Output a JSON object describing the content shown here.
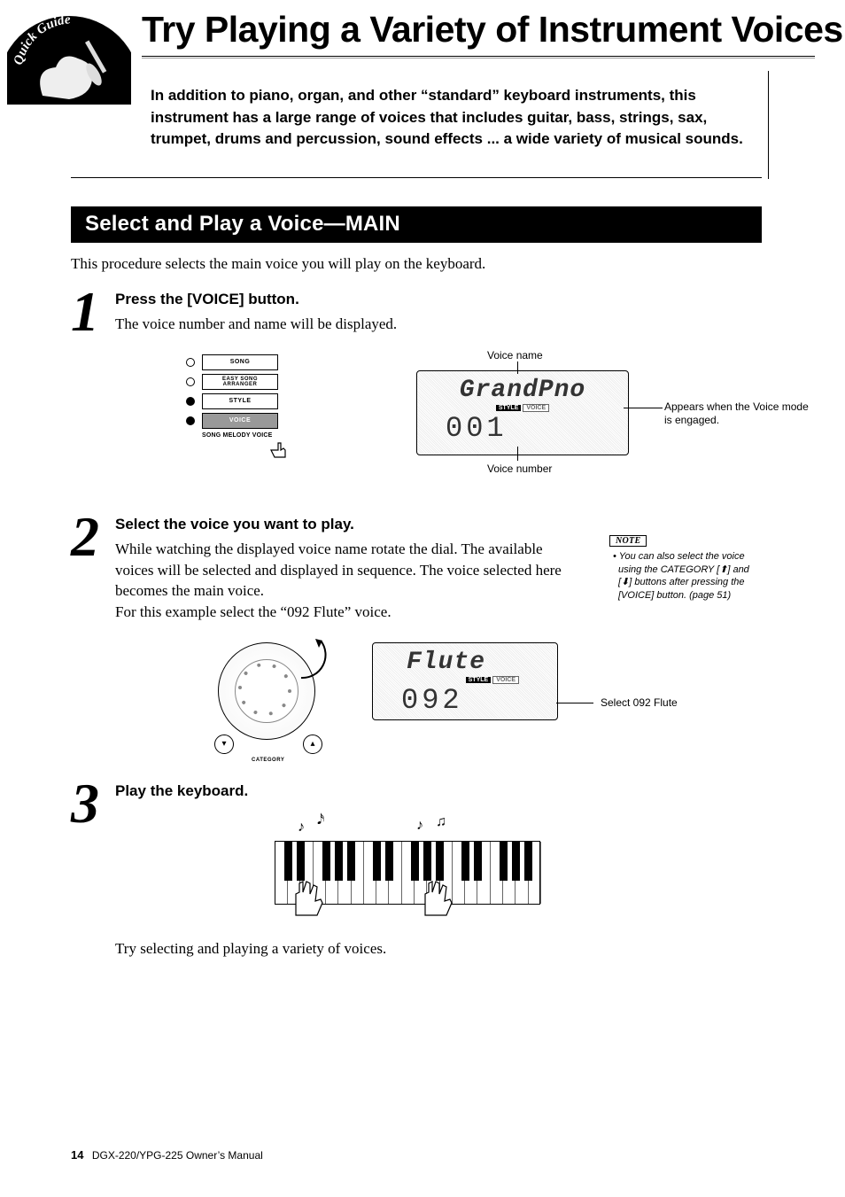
{
  "badge": {
    "label": "Quick Guide"
  },
  "title": "Try Playing a Variety of Instrument Voices",
  "intro": "In addition to piano, organ, and other “standard” keyboard instruments, this instrument has a large range of voices that includes guitar, bass, strings, sax, trumpet, drums and percussion, sound effects ... a wide variety of musical sounds.",
  "section_title": "Select and Play a Voice—MAIN",
  "section_intro": "This procedure selects the main voice you will play on the keyboard.",
  "steps": [
    {
      "num": "1",
      "head": "Press the [VOICE] button.",
      "desc": "The voice number and name will be displayed."
    },
    {
      "num": "2",
      "head": "Select the voice you want to play.",
      "desc": "While watching the displayed voice name rotate the dial. The available voices will be selected and displayed in sequence. The voice selected here becomes the main voice.\nFor this example select the “092 Flute” voice."
    },
    {
      "num": "3",
      "head": "Play the keyboard.",
      "desc": ""
    }
  ],
  "panel_buttons": {
    "song": "SONG",
    "easy": "EASY SONG\nARRANGER",
    "style": "STYLE",
    "voice": "VOICE",
    "melody": "SONG MELODY VOICE"
  },
  "lcd1": {
    "voice_name": "GrandPno",
    "voice_number": "001",
    "badge_style": "STYLE",
    "badge_voice": "VOICE"
  },
  "lcd2": {
    "voice_name": "Flute",
    "voice_number": "092"
  },
  "callouts": {
    "voice_name_label": "Voice name",
    "voice_number_label": "Voice number",
    "mode_engaged": "Appears when the Voice mode is engaged.",
    "select_flute": "Select 092 Flute"
  },
  "note": {
    "head": "NOTE",
    "body": "You can also select the voice using the CATEGORY [⬆] and [⬇] buttons after pressing the [VOICE] button. (page 51)"
  },
  "dial": {
    "category_label": "CATEGORY"
  },
  "closing": "Try selecting and playing a variety of voices.",
  "footer": {
    "page": "14",
    "doc": "DGX-220/YPG-225  Owner’s Manual"
  }
}
